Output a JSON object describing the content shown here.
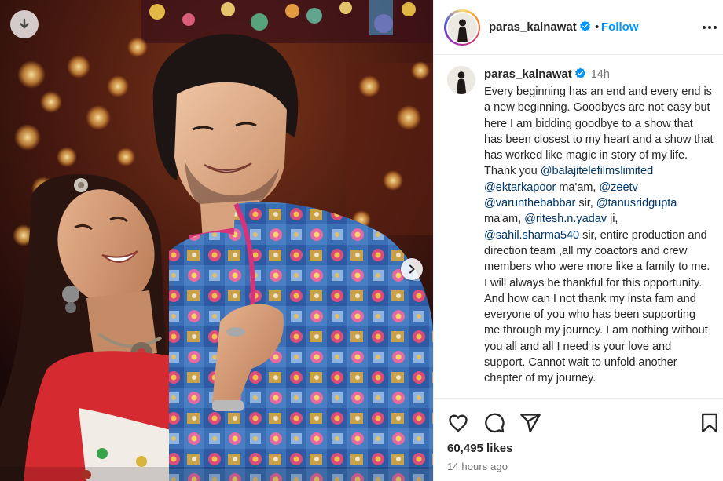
{
  "post": {
    "username": "paras_kalnawat",
    "verified": true,
    "follow_label": "Follow",
    "separator": "•",
    "time": "14h",
    "likes": "60,495 likes",
    "posted_ago": "14 hours ago",
    "caption_segments": [
      {
        "t": "text",
        "v": "Every beginning has an end and every end is a new beginning. Goodbyes are not easy but here I am bidding goodbye to a show that has been closest to my heart and a show that has worked like magic in story of my life. Thank you "
      },
      {
        "t": "mention",
        "v": "@balajitelefilmslimited"
      },
      {
        "t": "text",
        "v": " "
      },
      {
        "t": "mention",
        "v": "@ektarkapoor"
      },
      {
        "t": "text",
        "v": " ma'am, "
      },
      {
        "t": "mention",
        "v": "@zeetv"
      },
      {
        "t": "text",
        "v": " "
      },
      {
        "t": "mention",
        "v": "@varunthebabbar"
      },
      {
        "t": "text",
        "v": " sir, "
      },
      {
        "t": "mention",
        "v": "@tanusridgupta"
      },
      {
        "t": "text",
        "v": " ma'am, "
      },
      {
        "t": "mention",
        "v": "@ritesh.n.yadav"
      },
      {
        "t": "text",
        "v": " ji, "
      },
      {
        "t": "mention",
        "v": "@sahil.sharma540"
      },
      {
        "t": "text",
        "v": " sir, entire production and direction team ,all my coactors and crew members who were more like a family to me. I will always be thankful for this opportunity. And how can I not thank my insta fam and everyone of you who has been supporting me through my journey. I am nothing without you all and all I need is your love and support. Cannot wait to unfold another chapter of my journey."
      }
    ]
  },
  "icons": {
    "download": "download-arrow-icon",
    "next": "chevron-right-icon",
    "more": "more-options-icon",
    "like": "heart-icon",
    "comment": "comment-icon",
    "share": "share-icon",
    "save": "bookmark-icon",
    "verified": "verified-badge-icon"
  },
  "colors": {
    "link": "#0095f6",
    "mention": "#00376b",
    "verified": "#0095f6",
    "secondary_text": "#737373"
  }
}
